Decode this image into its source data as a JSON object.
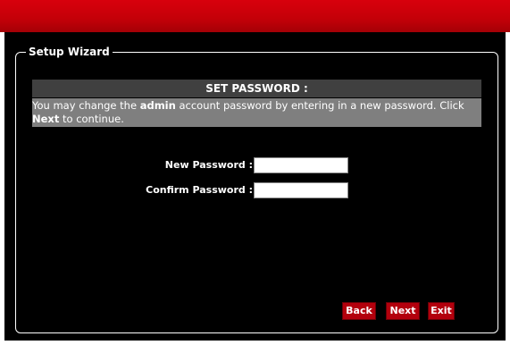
{
  "wizard": {
    "legend": "Setup Wizard"
  },
  "section": {
    "title": "SET PASSWORD :",
    "description_parts": {
      "p1": "You may change the ",
      "b1": "admin",
      "p2": " account password by entering in a new password. Click ",
      "b2": "Next",
      "p3": " to continue."
    }
  },
  "form": {
    "new_password_label": "New Password :",
    "new_password_value": "",
    "confirm_password_label": "Confirm Password :",
    "confirm_password_value": ""
  },
  "buttons": {
    "back": "Back",
    "next": "Next",
    "exit": "Exit"
  },
  "colors": {
    "banner": "#c30008",
    "button": "#b3000d",
    "header_bar": "#404040",
    "description_bar": "#7f7f7f"
  }
}
